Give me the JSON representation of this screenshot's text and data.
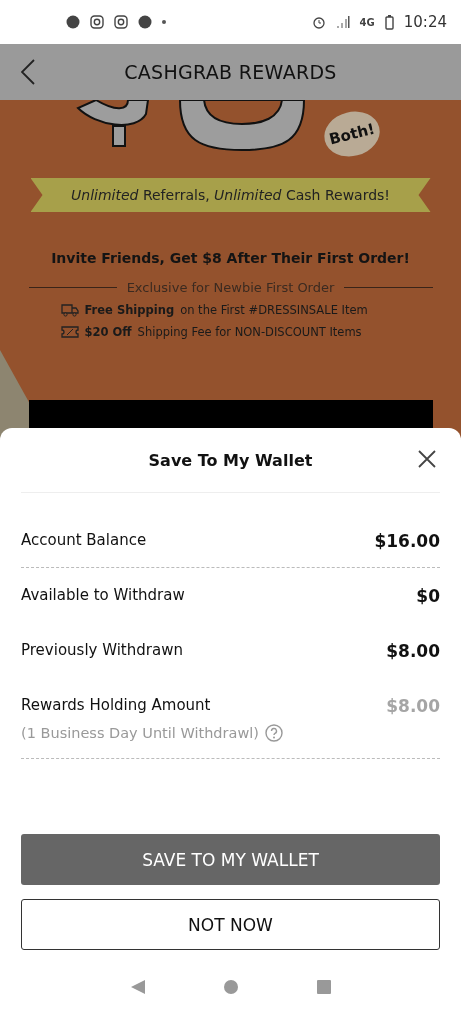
{
  "status_bar": {
    "time": "10:24",
    "network": "4G"
  },
  "header": {
    "title": "CASHGRAB REWARDS"
  },
  "promo": {
    "badge": "Both!",
    "ribbon": "*Unlimited* Referrals, *Unlimited* Cash Rewards!",
    "headline": "Invite Friends, Get $8 After Their First Order!",
    "subtitle": "Exclusive for Newbie First Order",
    "perks": [
      {
        "kind": "truck",
        "title": "Free Shipping",
        "text": "on the First #DRESSINSALE Item"
      },
      {
        "kind": "coupon",
        "title": "$20 Off",
        "text": "Shipping Fee for NON-DISCOUNT Items"
      }
    ]
  },
  "sheet": {
    "title": "Save To My Wallet",
    "rows": [
      {
        "label": "Account Balance",
        "value": "$16.00",
        "muted": false,
        "divider": true
      },
      {
        "label": "Available to Withdraw",
        "value": "$0",
        "muted": false,
        "divider": false
      },
      {
        "label": "Previously Withdrawn",
        "value": "$8.00",
        "muted": false,
        "divider": false
      },
      {
        "label": "Rewards Holding Amount",
        "value": "$8.00",
        "note": "(1 Business Day Until Withdrawl)",
        "muted": true,
        "divider": true
      }
    ],
    "primary_button": "SAVE TO MY WALLET",
    "secondary_button": "NOT NOW"
  }
}
